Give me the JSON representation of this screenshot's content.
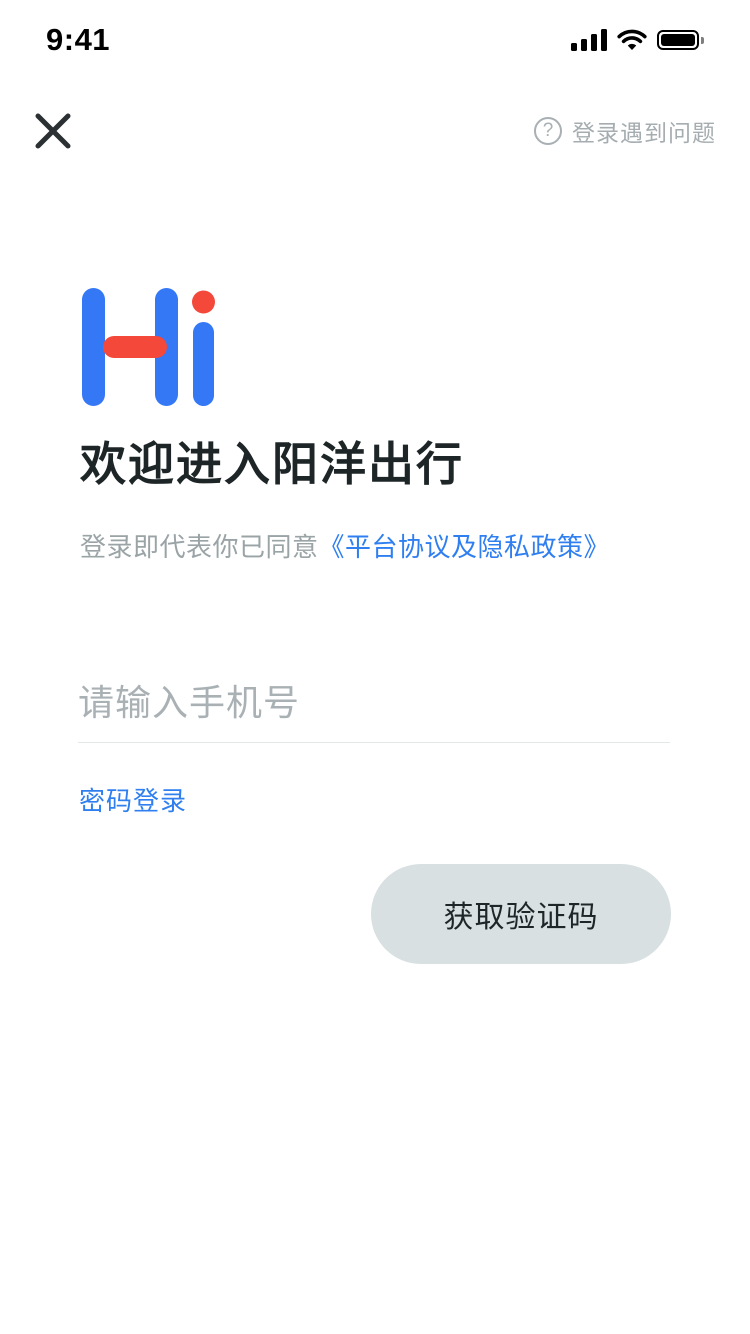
{
  "status_bar": {
    "time": "9:41",
    "icons": [
      "cellular-signal-icon",
      "wifi-icon",
      "battery-icon"
    ]
  },
  "nav": {
    "close_icon": "close-icon",
    "help_icon_glyph": "?",
    "help_text": "登录遇到问题"
  },
  "logo": {
    "text": "Hi",
    "colors": {
      "primary": "#3478f6",
      "accent": "#f4483b"
    }
  },
  "welcome": {
    "title": "欢迎进入阳洋出行"
  },
  "agreement": {
    "prefix": "登录即代表你已同意",
    "link": "《平台协议及隐私政策》"
  },
  "phone_input": {
    "value": "",
    "placeholder": "请输入手机号"
  },
  "password_login": "密码登录",
  "get_code_button": "获取验证码",
  "colors": {
    "link_blue": "#2f7ff0",
    "muted_gray": "#9aa3a6",
    "button_bg": "#d8e0e2",
    "title_text": "#1d2527"
  }
}
